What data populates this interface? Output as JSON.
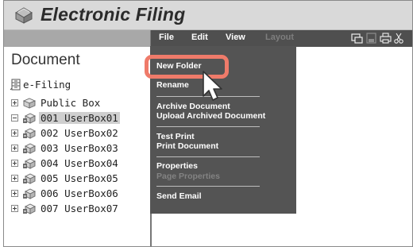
{
  "app": {
    "title": "Electronic Filing"
  },
  "menubar": {
    "items": [
      {
        "label": "File",
        "enabled": true
      },
      {
        "label": "Edit",
        "enabled": true
      },
      {
        "label": "View",
        "enabled": true
      },
      {
        "label": "Layout",
        "enabled": false
      }
    ],
    "tool_icons": [
      "view-icon",
      "save-icon",
      "print-icon",
      "scissors-icon"
    ]
  },
  "left_pane": {
    "title": "Document",
    "root": {
      "label": "e-Filing",
      "icon": "filing-cabinet-icon"
    },
    "boxes": [
      {
        "label": "Public Box",
        "expander": "plus",
        "icon": "public-box-icon",
        "selected": false
      },
      {
        "label": "001 UserBox01",
        "expander": "minus",
        "icon": "user-box-icon",
        "selected": true
      },
      {
        "label": "002 UserBox02",
        "expander": "plus",
        "icon": "user-box-icon",
        "selected": false
      },
      {
        "label": "003 UserBox03",
        "expander": "plus",
        "icon": "user-box-icon",
        "selected": false
      },
      {
        "label": "004 UserBox04",
        "expander": "plus",
        "icon": "user-box-icon",
        "selected": false
      },
      {
        "label": "005 UserBox05",
        "expander": "plus",
        "icon": "user-box-icon",
        "selected": false
      },
      {
        "label": "006 UserBox06",
        "expander": "plus",
        "icon": "user-box-icon",
        "selected": false
      },
      {
        "label": "007 UserBox07",
        "expander": "plus",
        "icon": "user-box-icon",
        "selected": false
      }
    ]
  },
  "file_menu": {
    "groups": [
      [
        {
          "label": "New Folder",
          "enabled": true,
          "highlighted": true
        },
        {
          "label": "Rename",
          "enabled": true
        }
      ],
      [
        {
          "label": "Archive Document",
          "enabled": true
        },
        {
          "label": "Upload Archived Document",
          "enabled": true
        }
      ],
      [
        {
          "label": "Test Print",
          "enabled": true
        },
        {
          "label": "Print Document",
          "enabled": true
        }
      ],
      [
        {
          "label": "Properties",
          "enabled": true
        },
        {
          "label": "Page Properties",
          "enabled": false
        }
      ],
      [
        {
          "label": "Send Email",
          "enabled": true
        }
      ]
    ]
  },
  "colors": {
    "menubar_bg": "#4f4f4f",
    "dropdown_bg": "#545454",
    "highlight_border": "#ef7b6a",
    "disabled_text": "#838383",
    "titlebar_bg": "#d9d9d9"
  }
}
